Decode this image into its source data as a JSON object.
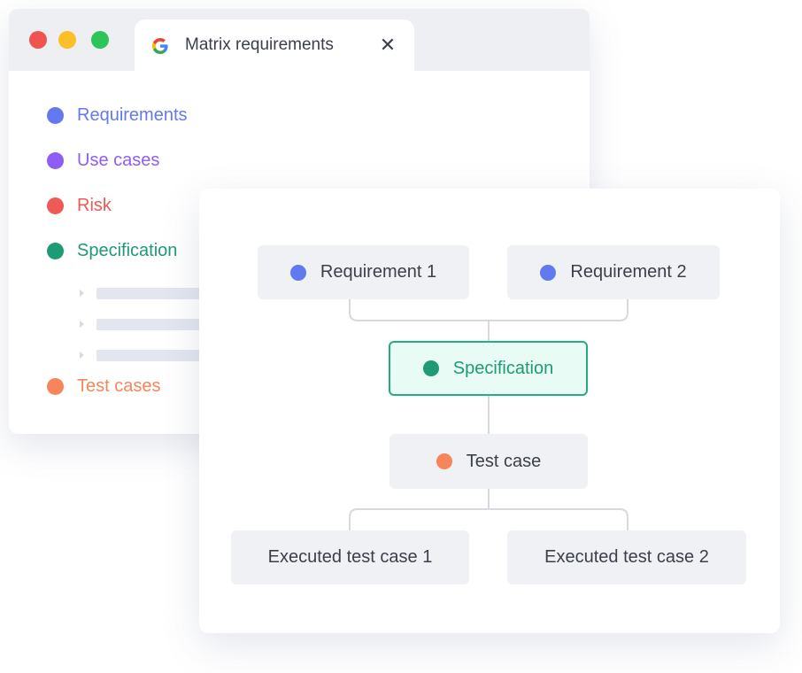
{
  "browser": {
    "tab": {
      "title": "Matrix requirements",
      "close_glyph": "✕",
      "favicon": "google-g-icon"
    },
    "traffic_lights": {
      "red": "#ef5451",
      "yellow": "#fbbf27",
      "green": "#2dc45a"
    }
  },
  "sidebar": {
    "items": [
      {
        "label": "Requirements",
        "color": "#6279f0"
      },
      {
        "label": "Use cases",
        "color": "#8f5cf5"
      },
      {
        "label": "Risk",
        "color": "#ef5956"
      },
      {
        "label": "Specification",
        "color": "#1e9a76"
      },
      {
        "label": "Test cases",
        "color": "#f7855a"
      }
    ],
    "sub_items_count_shown": 3
  },
  "diagram": {
    "requirement_1": {
      "label": "Requirement 1",
      "dot_color": "#6279f0"
    },
    "requirement_2": {
      "label": "Requirement 2",
      "dot_color": "#6279f0"
    },
    "specification": {
      "label": "Specification",
      "dot_color": "#1e9a76"
    },
    "test_case": {
      "label": "Test case",
      "dot_color": "#f7855a"
    },
    "executed_1": {
      "label": "Executed test case 1"
    },
    "executed_2": {
      "label": "Executed test case 2"
    },
    "connector_color": "#d6d9e0"
  }
}
